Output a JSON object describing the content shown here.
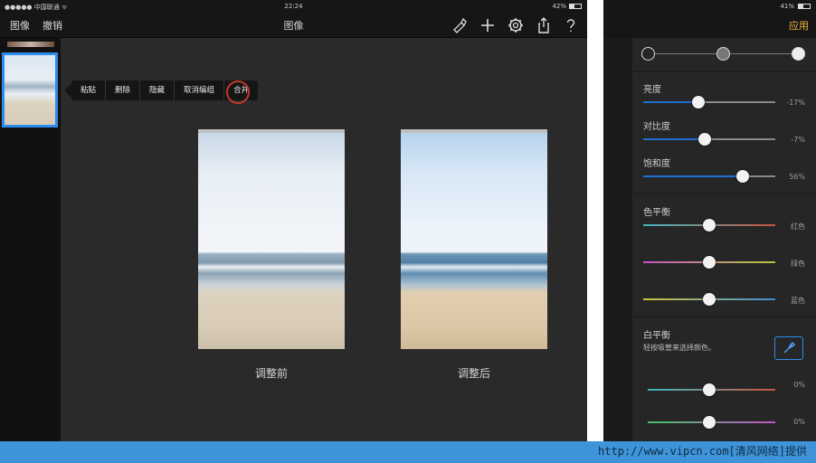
{
  "status": {
    "carrier": "●●●●● 中国联通 ᯤ",
    "time": "22:24",
    "battery_left": "42%",
    "battery_right": "41%"
  },
  "toolbar": {
    "image_label": "图像",
    "undo_label": "撤销",
    "title": "图像",
    "icons": [
      "paintbrush-icon",
      "plus-icon",
      "gear-icon",
      "share-icon",
      "help-icon"
    ]
  },
  "context_menu": [
    "粘贴",
    "删除",
    "隐藏",
    "取消编组",
    "合并"
  ],
  "photos": {
    "before_label": "调整前",
    "after_label": "调整后"
  },
  "panel": {
    "apply_label": "应用",
    "brightness": {
      "label": "亮度",
      "value": "-17%",
      "level": 0.4
    },
    "contrast": {
      "label": "对比度",
      "value": "-7%",
      "level": 0.46
    },
    "saturation": {
      "label": "饱和度",
      "value": "56%",
      "level": 0.76
    },
    "color_balance": {
      "label": "色平衡",
      "red": "红色",
      "green": "绿色",
      "blue": "蓝色"
    },
    "white_balance": {
      "label": "白平衡",
      "hint": "轻按吸管来选择颜色。",
      "v1": "0%",
      "v2": "0%"
    }
  },
  "footer": {
    "text": "http://www.vipcn.com[清风网络]提供"
  },
  "colors": {
    "accent": "#2d8bf0",
    "apply": "#f0b33c",
    "highlight_ring": "#c0392b"
  }
}
